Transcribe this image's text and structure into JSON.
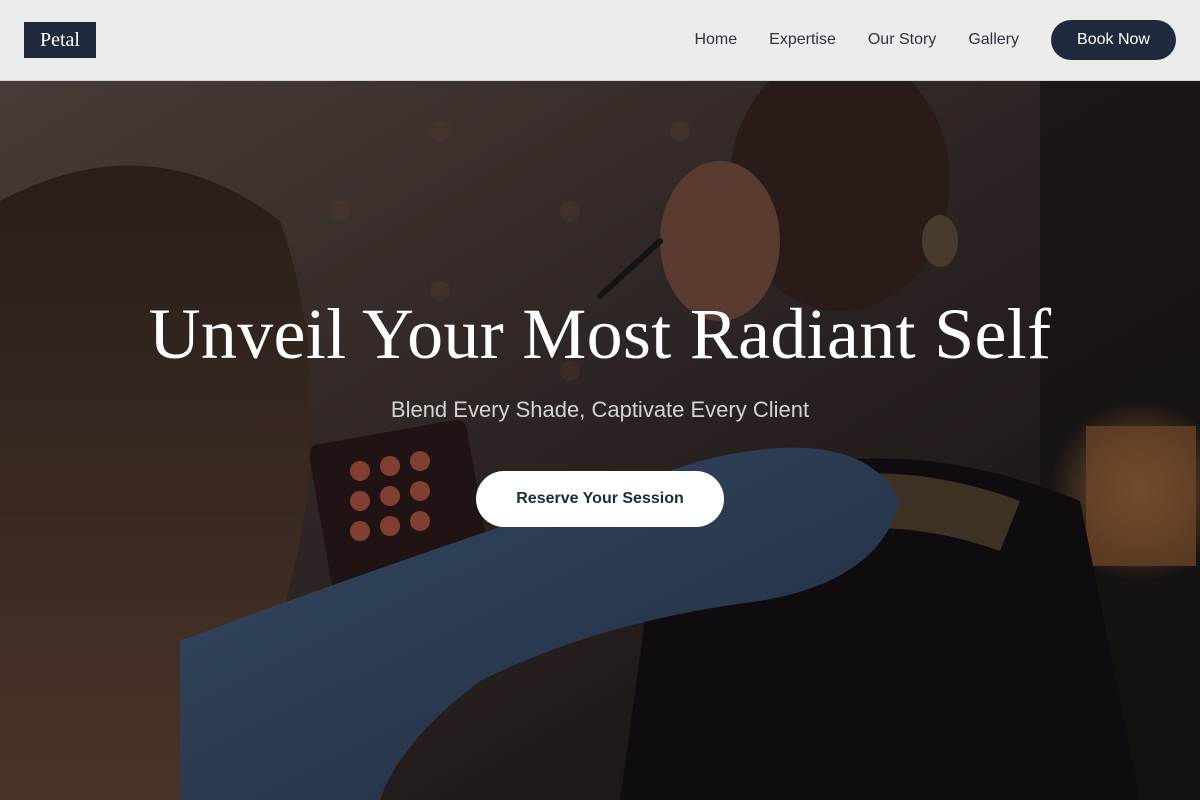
{
  "brand": {
    "logo_text": "Petal"
  },
  "nav": {
    "links": [
      {
        "label": "Home"
      },
      {
        "label": "Expertise"
      },
      {
        "label": "Our Story"
      },
      {
        "label": "Gallery"
      }
    ],
    "cta_label": "Book Now"
  },
  "hero": {
    "title": "Unveil Your Most Radiant Self",
    "subtitle": "Blend Every Shade, Captivate Every Client",
    "cta_label": "Reserve Your Session"
  },
  "colors": {
    "primary": "#1e2a3b",
    "header_bg": "#ececec",
    "hero_text": "#ffffff",
    "subtitle_text": "#d3d3d3"
  }
}
